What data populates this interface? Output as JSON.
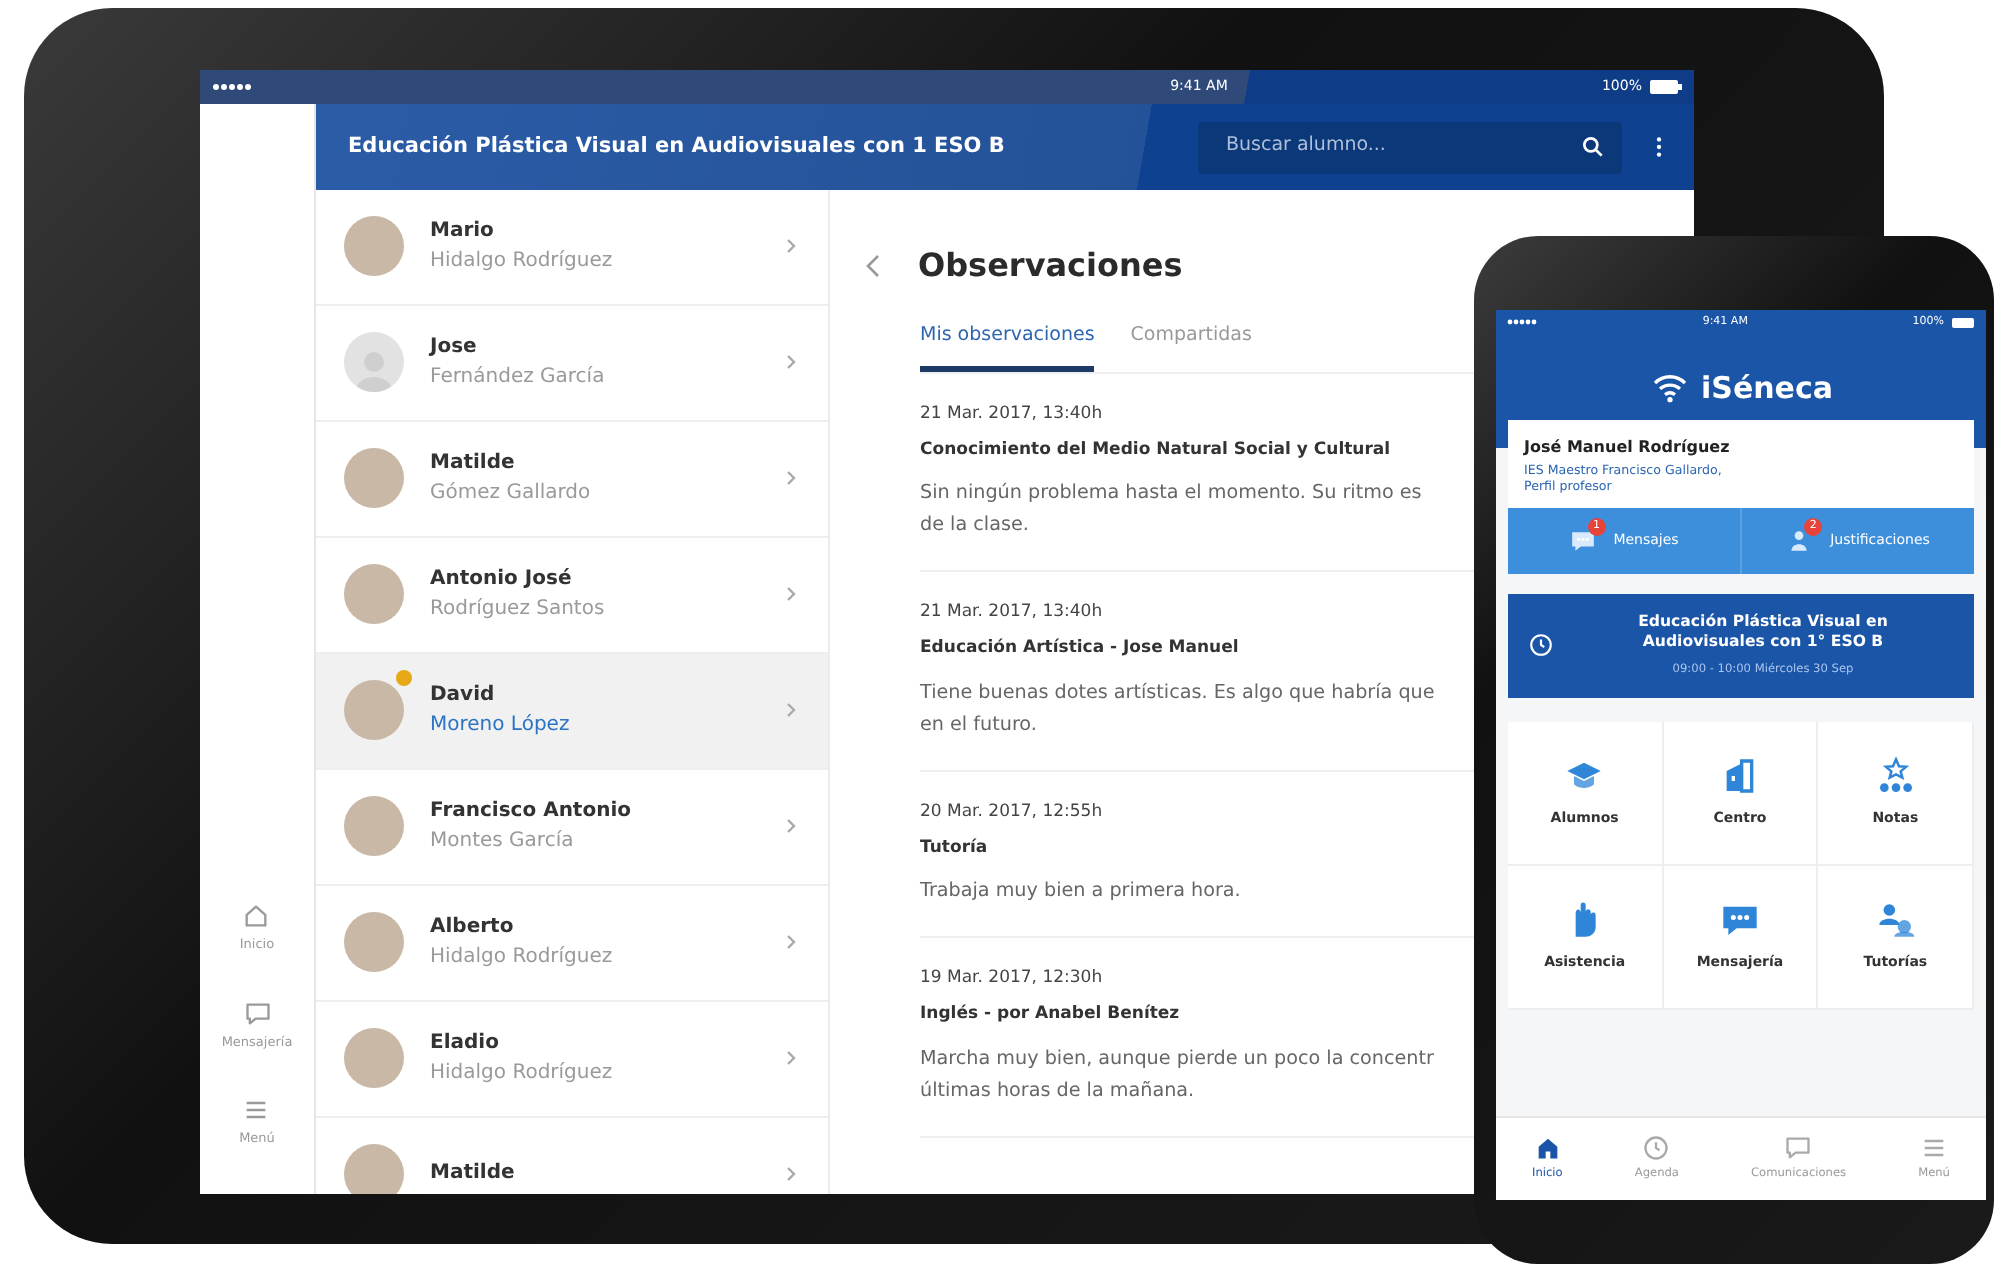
{
  "tablet": {
    "status_bar": {
      "time": "9:41 AM",
      "battery": "100%"
    },
    "header": {
      "title": "Educación Plástica Visual en Audiovisuales con 1 ESO B",
      "search": {
        "placeholder": "Buscar alumno..."
      }
    },
    "rail": [
      {
        "label": "Inicio"
      },
      {
        "label": "Mensajería"
      },
      {
        "label": "Menú"
      }
    ],
    "students": [
      {
        "first": "Mario",
        "last": "Hidalgo Rodríguez",
        "kind": "photo",
        "selected": false,
        "flagged": false
      },
      {
        "first": "Jose",
        "last": "Fernández García",
        "kind": "placeholder",
        "selected": false,
        "flagged": false
      },
      {
        "first": "Matilde",
        "last": "Gómez Gallardo",
        "kind": "photo",
        "selected": false,
        "flagged": false
      },
      {
        "first": "Antonio José",
        "last": "Rodríguez Santos",
        "kind": "photo",
        "selected": false,
        "flagged": false
      },
      {
        "first": "David",
        "last": "Moreno López",
        "kind": "photo",
        "selected": true,
        "flagged": true
      },
      {
        "first": "Francisco Antonio",
        "last": "Montes García",
        "kind": "photo",
        "selected": false,
        "flagged": false
      },
      {
        "first": "Alberto",
        "last": "Hidalgo Rodríguez",
        "kind": "photo",
        "selected": false,
        "flagged": false
      },
      {
        "first": "Eladio",
        "last": "Hidalgo Rodríguez",
        "kind": "photo",
        "selected": false,
        "flagged": false
      },
      {
        "first": "Matilde",
        "kind": "photo",
        "selected": false,
        "flagged": false
      }
    ],
    "detail": {
      "title": "Observaciones",
      "tabs": [
        {
          "label": "Mis observaciones",
          "selected": true
        },
        {
          "label": "Compartidas",
          "selected": false
        }
      ],
      "observations": [
        {
          "date": "21 Mar. 2017,  13:40h",
          "subject": "Conocimiento del Medio Natural Social y Cultural",
          "lines": [
            "Sin ningún problema hasta el momento. Su ritmo es",
            "de la clase."
          ]
        },
        {
          "date": "21 Mar. 2017,  13:40h",
          "subject": "Educación Artística - Jose Manuel",
          "lines": [
            "Tiene buenas dotes artísticas. Es algo que habría que",
            "en el futuro."
          ]
        },
        {
          "date": "20 Mar. 2017,  12:55h",
          "subject": "Tutoría",
          "lines": [
            "Trabaja muy bien a primera hora."
          ]
        },
        {
          "date": "19 Mar. 2017,  12:30h",
          "subject": "Inglés - por Anabel Benítez",
          "lines": [
            "Marcha muy bien, aunque pierde un poco la concentr",
            "últimas horas de la mañana."
          ]
        }
      ]
    }
  },
  "phone": {
    "status_bar": {
      "time": "9:41 AM",
      "battery": "100%"
    },
    "app_name": "iSéneca",
    "profile": {
      "name": "José Manuel Rodríguez",
      "school": "IES Maestro Francisco Gallardo,",
      "role": "Perfil profesor"
    },
    "shortcuts": [
      {
        "label": "Mensajes",
        "count": "1"
      },
      {
        "label": "Justificaciones",
        "count": "2"
      }
    ],
    "class": {
      "title": "Educación Plástica Visual en Audiovisuales con 1° ESO B",
      "time": "09:00 - 10:00",
      "day": "Miércoles 30 Sep"
    },
    "tiles": [
      {
        "label": "Alumnos"
      },
      {
        "label": "Centro"
      },
      {
        "label": "Notas"
      },
      {
        "label": "Asistencia"
      },
      {
        "label": "Mensajería"
      },
      {
        "label": "Tutorías"
      }
    ],
    "nav": [
      {
        "label": "Inicio",
        "selected": true
      },
      {
        "label": "Agenda",
        "selected": false
      },
      {
        "label": "Comunicaciones",
        "selected": false
      },
      {
        "label": "Menú",
        "selected": false
      }
    ]
  }
}
